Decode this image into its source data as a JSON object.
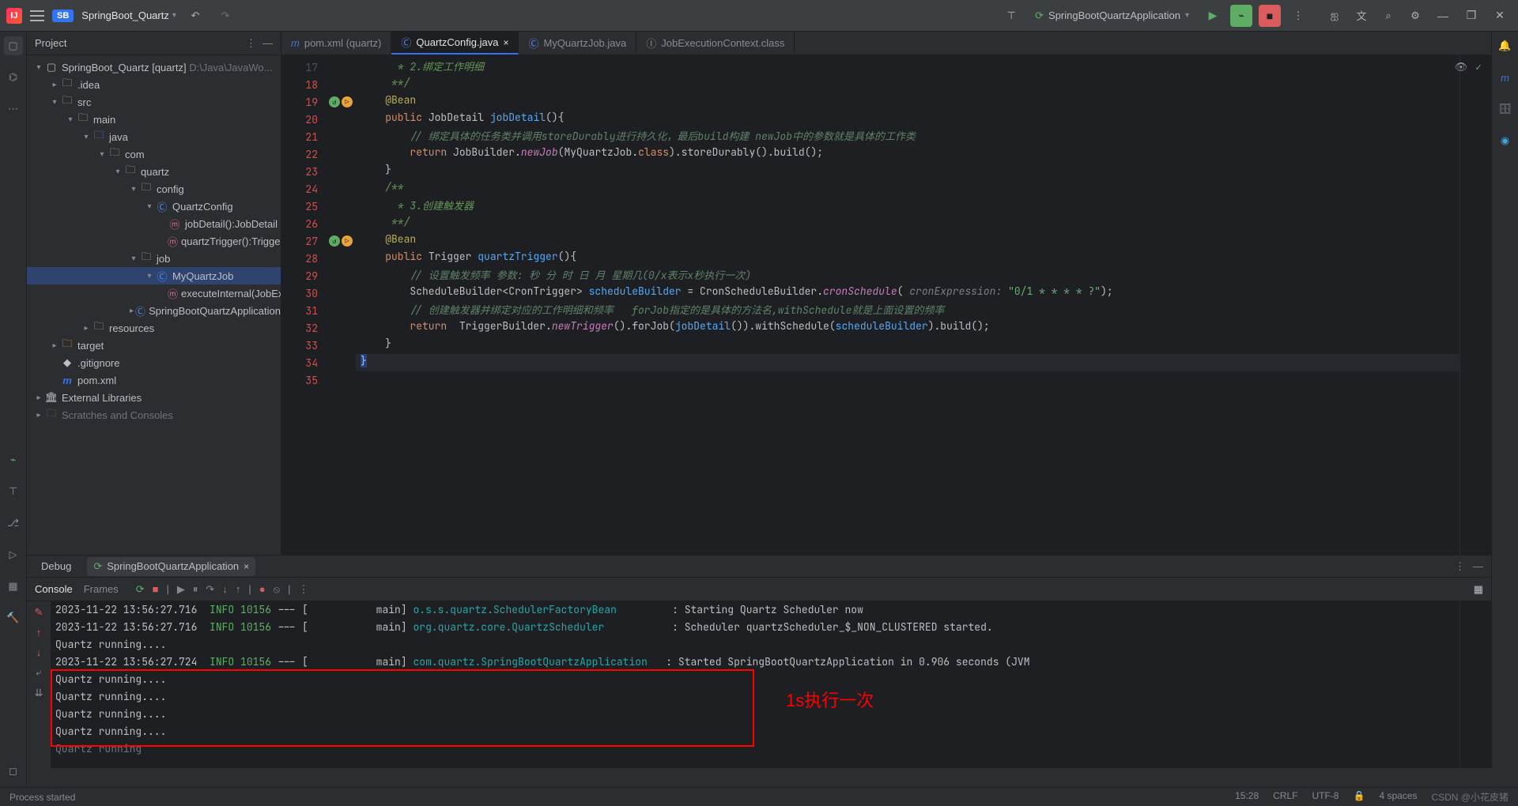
{
  "titlebar": {
    "project_badge": "SB",
    "project_name": "SpringBoot_Quartz",
    "run_config": "SpringBootQuartzApplication"
  },
  "project_panel": {
    "title": "Project",
    "root": "SpringBoot_Quartz",
    "root_qualifier": "[quartz]",
    "root_path": "D:\\Java\\JavaWo...",
    "items": {
      "idea": ".idea",
      "src": "src",
      "main": "main",
      "java": "java",
      "com": "com",
      "quartz": "quartz",
      "config": "config",
      "quartz_config": "QuartzConfig",
      "job_detail": "jobDetail():JobDetail",
      "quartz_trigger": "quartzTrigger():Trigger",
      "job": "job",
      "my_quartz_job": "MyQuartzJob",
      "execute_internal": "executeInternal(JobExe",
      "app": "SpringBootQuartzApplication",
      "resources": "resources",
      "target": "target",
      "gitignore": ".gitignore",
      "pom": "pom.xml",
      "ext_lib": "External Libraries",
      "scratches": "Scratches and Consoles"
    }
  },
  "tabs": {
    "pom": "pom.xml (quartz)",
    "quartz_config": "QuartzConfig.java",
    "my_quartz_job": "MyQuartzJob.java",
    "job_ctx": "JobExecutionContext.class"
  },
  "editor": {
    "lines": {
      "17": " * 2.绑定工作明细",
      "18": " **/",
      "19_anno": "@Bean",
      "20_kw": "public",
      "20_typ": "JobDetail",
      "20_fn": "jobDetail",
      "21": "// 绑定具体的任务类并调用storeDurably进行持久化，最后build构建 newJob中的参数就是具体的工作类",
      "22_ret": "return",
      "22_a": "JobBuilder.",
      "22_b": "newJob",
      "22_c": "(MyQuartzJob.",
      "22_d": "class",
      "22_e": ").storeDurably().build();",
      "25": " * 3.创建触发器",
      "27_anno": "@Bean",
      "28_kw": "public",
      "28_typ": "Trigger",
      "28_fn": "quartzTrigger",
      "29": "// 设置触发频率 参数: 秒 分 时 日 月 星期几(0/x表示x秒执行一次)",
      "30_a": "ScheduleBuilder<CronTrigger> ",
      "30_b": "scheduleBuilder",
      "30_c": " = CronScheduleBuilder.",
      "30_d": "cronSchedule",
      "30_e": "cronExpression:",
      "30_f": "\"0/1 * * * * ?\"",
      "31": "// 创建触发器并绑定对应的工作明细和频率   forJob指定的是具体的方法名,withSchedule就是上面设置的频率",
      "32_ret": "return",
      "32_a": "  TriggerBuilder.",
      "32_b": "newTrigger",
      "32_c": "().forJob(",
      "32_d": "jobDetail",
      "32_e": "()).withSchedule(",
      "32_f": "scheduleBuilder",
      "32_g": ").build();"
    }
  },
  "debug": {
    "label": "Debug",
    "app_tab": "SpringBootQuartzApplication",
    "console": "Console",
    "frames": "Frames",
    "log1_ts": "2023-11-22 13:56:27.716",
    "log1_lvl": "INFO",
    "log1_pid": "10156",
    "log1_thr": "main",
    "log1_cls": "o.s.s.quartz.SchedulerFactoryBean",
    "log1_msg": "Starting Quartz Scheduler now",
    "log2_ts": "2023-11-22 13:56:27.716",
    "log2_lvl": "INFO",
    "log2_pid": "10156",
    "log2_thr": "main",
    "log2_cls": "org.quartz.core.QuartzScheduler",
    "log2_msg": "Scheduler quartzScheduler_$_NON_CLUSTERED started.",
    "log3": "Quartz running....",
    "log4_ts": "2023-11-22 13:56:27.724",
    "log4_lvl": "INFO",
    "log4_pid": "10156",
    "log4_thr": "main",
    "log4_cls": "com.quartz.SpringBootQuartzApplication",
    "log4_msg": "Started SpringBootQuartzApplication in 0.906 seconds (JVM",
    "q1": "Quartz running....",
    "q2": "Quartz running....",
    "q3": "Quartz running....",
    "q4": "Quartz running....",
    "q5": "Quartz running",
    "annotation": "1s执行一次"
  },
  "status": {
    "left": "Process started",
    "time": "15:28",
    "crlf": "CRLF",
    "enc": "UTF-8",
    "indent": "4 spaces",
    "watermark": "CSDN @小花皮猪"
  }
}
